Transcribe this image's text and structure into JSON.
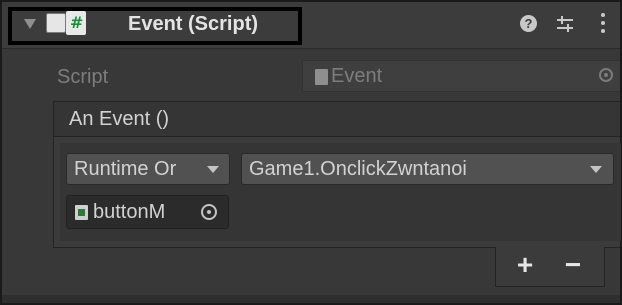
{
  "component": {
    "title": "Event (Script)",
    "help_glyph": "?"
  },
  "script_row": {
    "label": "Script",
    "value": "Event"
  },
  "event": {
    "header": "An Event ()",
    "listener": {
      "runtime_mode": "Runtime Or",
      "function": "Game1.OnclickZwntanoi",
      "target_object": "buttonM"
    },
    "add_label": "+",
    "remove_label": "−"
  },
  "colors": {
    "background": "#383838",
    "header_highlight": "#000000",
    "script_hash_green": "#1c8f3a"
  }
}
